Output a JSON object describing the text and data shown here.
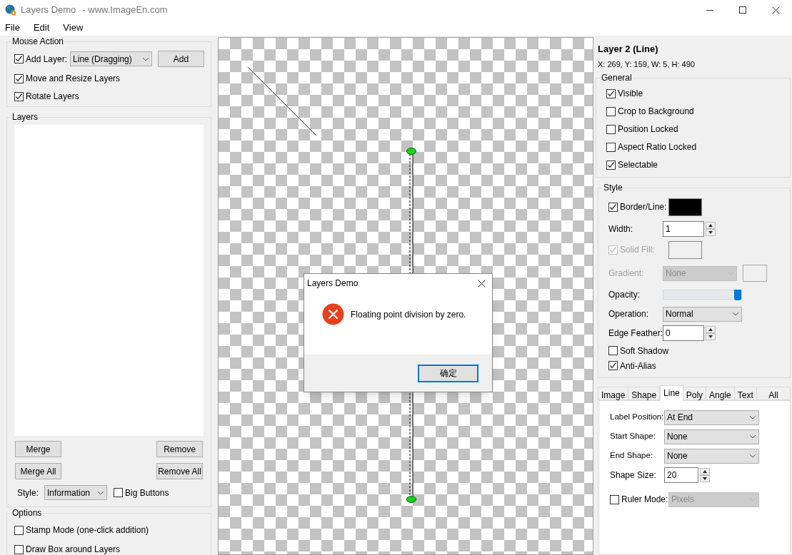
{
  "window": {
    "title": "Layers Demo",
    "subtitle": "- www.ImageEn.com"
  },
  "menu": [
    "File",
    "Edit",
    "View"
  ],
  "mouse_action": {
    "title": "Mouse Action",
    "add_layer": {
      "label": "Add Layer:",
      "checked": true,
      "value": "Line (Dragging)",
      "button": "Add"
    },
    "options": [
      {
        "label": "Move and Resize Layers",
        "checked": true
      },
      {
        "label": "Rotate Layers",
        "checked": true
      }
    ]
  },
  "layers": {
    "title": "Layers",
    "buttons": [
      "Merge",
      "Remove",
      "Merge All",
      "Remove All"
    ],
    "style_label": "Style:",
    "style_value": "Information",
    "big_buttons": {
      "label": "Big Buttons",
      "checked": false
    }
  },
  "options": {
    "title": "Options",
    "items": [
      {
        "label": "Stamp Mode (one-click addition)",
        "checked": false
      },
      {
        "label": "Draw Box around Layers",
        "checked": false
      }
    ]
  },
  "dialog": {
    "title": "Layers Demo",
    "message": "Floating point division by zero.",
    "button": "确定"
  },
  "layer": {
    "title": "Layer 2 (Line)",
    "info": "X: 269, Y: 159, W: 5, H: 490"
  },
  "general": {
    "title": "General",
    "items": [
      {
        "label": "Visible",
        "checked": true
      },
      {
        "label": "Crop to Background",
        "checked": false
      },
      {
        "label": "Position Locked",
        "checked": false
      },
      {
        "label": "Aspect Ratio Locked",
        "checked": false
      },
      {
        "label": "Selectable",
        "checked": true
      }
    ]
  },
  "style": {
    "title": "Style",
    "rows": [
      {
        "kind": "color-check",
        "label": "Border/Line:",
        "checked": true,
        "disabled": false,
        "color": "#000000"
      },
      {
        "kind": "spin",
        "label": "Width:",
        "value": "1"
      },
      {
        "kind": "color-check",
        "label": "Solid Fill:",
        "checked": true,
        "disabled": true,
        "color": "#f0f0f0"
      },
      {
        "kind": "gradient",
        "label": "Gradient:",
        "value": "None",
        "disabled": true
      },
      {
        "kind": "slider",
        "label": "Opacity:",
        "level": 1
      },
      {
        "kind": "select",
        "label": "Operation:",
        "value": "Normal",
        "disabled": false
      },
      {
        "kind": "spin",
        "label": "Edge Feather:",
        "value": "0"
      },
      {
        "kind": "check",
        "label": "Soft Shadow",
        "checked": false
      },
      {
        "kind": "check",
        "label": "Anti-Alias",
        "checked": true
      }
    ]
  },
  "tabs": [
    {
      "label": "Image",
      "selected": false
    },
    {
      "label": "Shape",
      "selected": false
    },
    {
      "label": "Line",
      "selected": true
    },
    {
      "label": "Poly",
      "selected": false
    },
    {
      "label": "Angle",
      "selected": false
    },
    {
      "label": "Text",
      "selected": false
    },
    {
      "label": "All",
      "selected": false
    }
  ],
  "line_tab": {
    "rows": [
      {
        "kind": "select",
        "label": "Label Position:",
        "value": "At End",
        "disabled": false
      },
      {
        "kind": "select",
        "label": "Start Shape:",
        "value": "None",
        "disabled": false
      },
      {
        "kind": "select",
        "label": "End Shape:",
        "value": "None",
        "disabled": false
      },
      {
        "kind": "spin",
        "label": "Shape Size:",
        "value": "20"
      },
      {
        "kind": "check-select",
        "label": "Ruler Mode:",
        "checked": false,
        "value": "Pixels",
        "disabled": true
      }
    ]
  }
}
